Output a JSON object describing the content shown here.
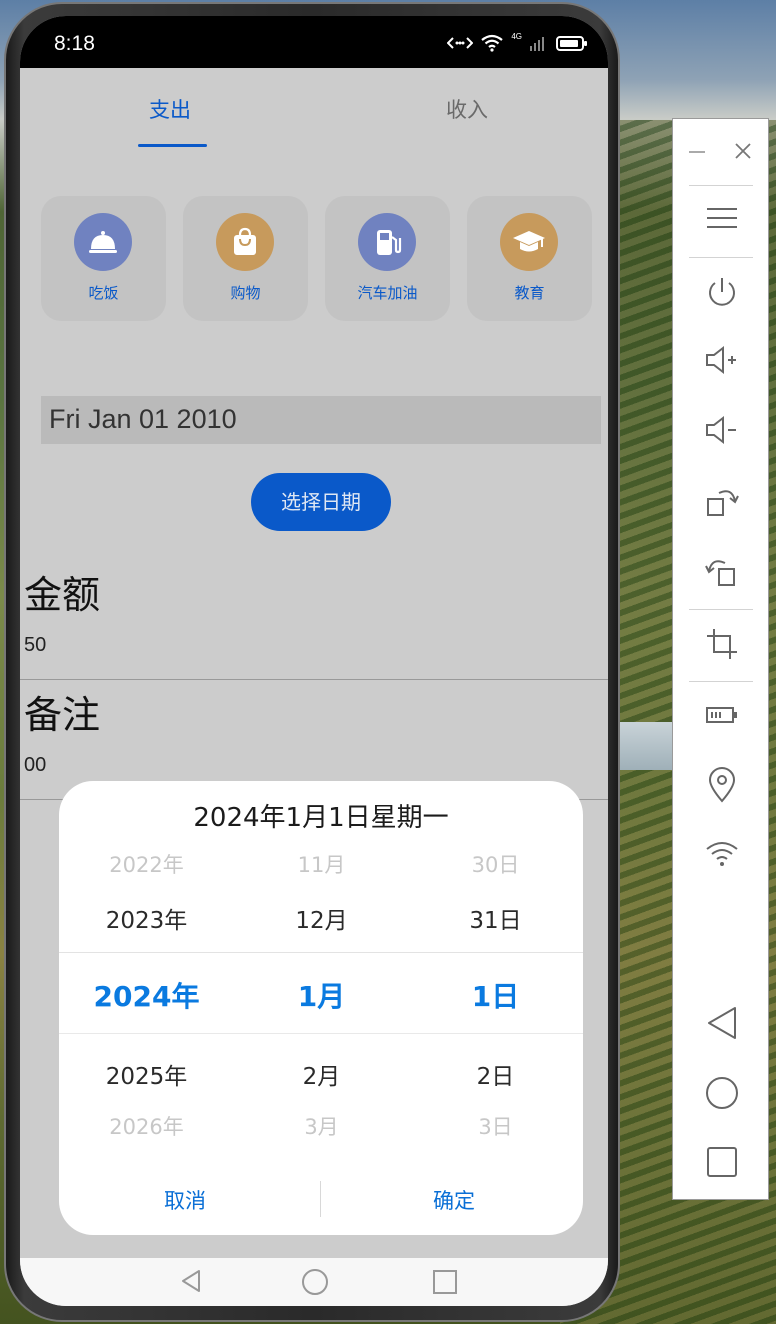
{
  "status_bar": {
    "time": "8:18",
    "network": "4G"
  },
  "tabs": [
    {
      "label": "支出",
      "active": true
    },
    {
      "label": "收入",
      "active": false
    }
  ],
  "categories": [
    {
      "label": "吃饭",
      "icon": "dinner-bell-icon",
      "color": "#7082c0"
    },
    {
      "label": "购物",
      "icon": "shopping-bag-icon",
      "color": "#c79a5c"
    },
    {
      "label": "汽车加油",
      "icon": "fuel-pump-icon",
      "color": "#7082c0"
    },
    {
      "label": "教育",
      "icon": "graduation-cap-icon",
      "color": "#c79a5c"
    }
  ],
  "form": {
    "date_value": "Fri Jan 01 2010",
    "choose_date_label": "选择日期",
    "amount_label": "金额",
    "amount_value": "50",
    "note_label": "备注",
    "note_value": "00"
  },
  "date_picker": {
    "title": "2024年1月1日星期一",
    "years": [
      "2022年",
      "2023年",
      "2024年",
      "2025年",
      "2026年"
    ],
    "months": [
      "11月",
      "12月",
      "1月",
      "2月",
      "3月"
    ],
    "days": [
      "30日",
      "31日",
      "1日",
      "2日",
      "3日"
    ],
    "cancel_label": "取消",
    "confirm_label": "确定"
  },
  "colors": {
    "accent": "#0a59c9",
    "picker_selected": "#0a7ae0"
  },
  "emulator_toolbar": [
    "minimize-icon",
    "close-icon",
    "menu-icon",
    "power-icon",
    "volume-up-icon",
    "volume-down-icon",
    "rotate-right-icon",
    "rotate-left-icon",
    "crop-icon",
    "battery-icon",
    "location-icon",
    "wifi-icon",
    "back-icon",
    "home-icon",
    "recent-apps-icon"
  ]
}
